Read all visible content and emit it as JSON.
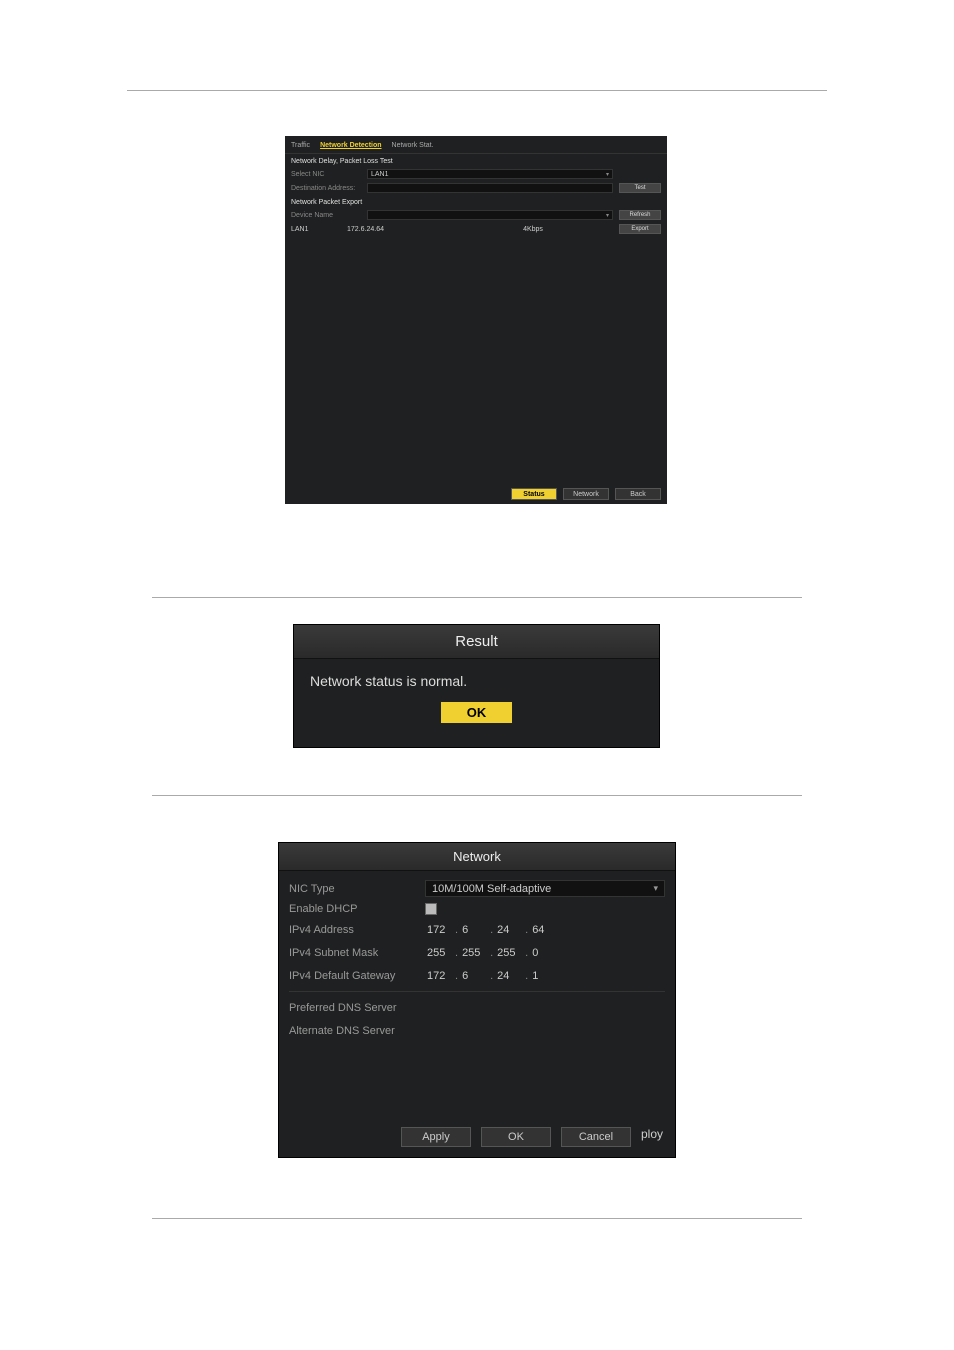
{
  "screen1": {
    "tabs": {
      "traffic": "Traffic",
      "detection": "Network Detection",
      "stat": "Network Stat."
    },
    "section_delay": "Network Delay, Packet Loss Test",
    "select_nic_label": "Select NIC",
    "select_nic_value": "LAN1",
    "dest_label": "Destination Address:",
    "test_btn": "Test",
    "section_export": "Network Packet Export",
    "device_label": "Device Name",
    "refresh_btn": "Refresh",
    "export_row": {
      "nic": "LAN1",
      "ip": "172.6.24.64",
      "rate": "4Kbps"
    },
    "export_btn": "Export",
    "footer": {
      "status": "Status",
      "network": "Network",
      "back": "Back"
    }
  },
  "screen2": {
    "title": "Result",
    "message": "Network status is normal.",
    "ok": "OK"
  },
  "screen3": {
    "title": "Network",
    "nic_type_label": "NIC Type",
    "nic_type_value": "10M/100M Self-adaptive",
    "dhcp_label": "Enable DHCP",
    "ipv4_addr_label": "IPv4 Address",
    "ipv4_addr": {
      "a": "172",
      "b": "6",
      "c": "24",
      "d": "64"
    },
    "ipv4_mask_label": "IPv4 Subnet Mask",
    "ipv4_mask": {
      "a": "255",
      "b": "255",
      "c": "255",
      "d": "0"
    },
    "ipv4_gw_label": "IPv4 Default Gateway",
    "ipv4_gw": {
      "a": "172",
      "b": "6",
      "c": "24",
      "d": "1"
    },
    "pref_dns_label": "Preferred DNS Server",
    "alt_dns_label": "Alternate DNS Server",
    "footer": {
      "apply": "Apply",
      "ok": "OK",
      "cancel": "Cancel"
    }
  }
}
